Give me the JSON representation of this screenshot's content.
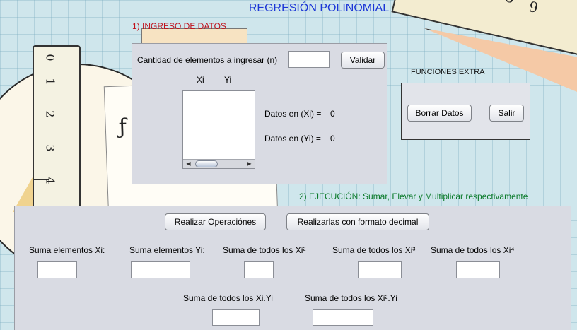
{
  "app": {
    "title": "REGRESIÓN POLINOMIAL"
  },
  "section_input": {
    "title": "1) INGRESO DE DATOS",
    "count_label": "Cantidad de elementos a ingresar (n)",
    "count_value": "",
    "validate_label": "Validar",
    "col_xi": "Xi",
    "col_yi": "Yi",
    "datos_xi_label": "Datos en (Xi) =",
    "datos_xi_value": "0",
    "datos_yi_label": "Datos en (Yi) =",
    "datos_yi_value": "0"
  },
  "section_extra": {
    "title": "FUNCIONES EXTRA",
    "clear_label": "Borrar Datos",
    "exit_label": "Salir"
  },
  "section_ops": {
    "title": "2) EJECUCIÓN: Sumar, Elevar y Multiplicar respectivamente",
    "run_label": "Realizar Operaciónes",
    "run_decimal_label": "Realizarlas con formato decimal",
    "sum_xi_label": "Suma elementos Xi:",
    "sum_yi_label": "Suma elementos Yi:",
    "sum_xi2_label": "Suma de todos los  Xi²",
    "sum_xi3_label": "Suma de todos los Xi³",
    "sum_xi4_label": "Suma de todos los Xi⁴",
    "sum_xiyi_label": "Suma de todos los  Xi.Yi",
    "sum_xi2yi_label": "Suma de todos los Xi².Yi",
    "sum_xi_value": "",
    "sum_yi_value": "",
    "sum_xi2_value": "",
    "sum_xi3_value": "",
    "sum_xi4_value": "",
    "sum_xiyi_value": "",
    "sum_xi2yi_value": ""
  },
  "colors": {
    "title": "#1b36d6",
    "section_input": "#c0101a",
    "section_ops": "#0a7a2a",
    "panel": "#d9dbe3"
  }
}
